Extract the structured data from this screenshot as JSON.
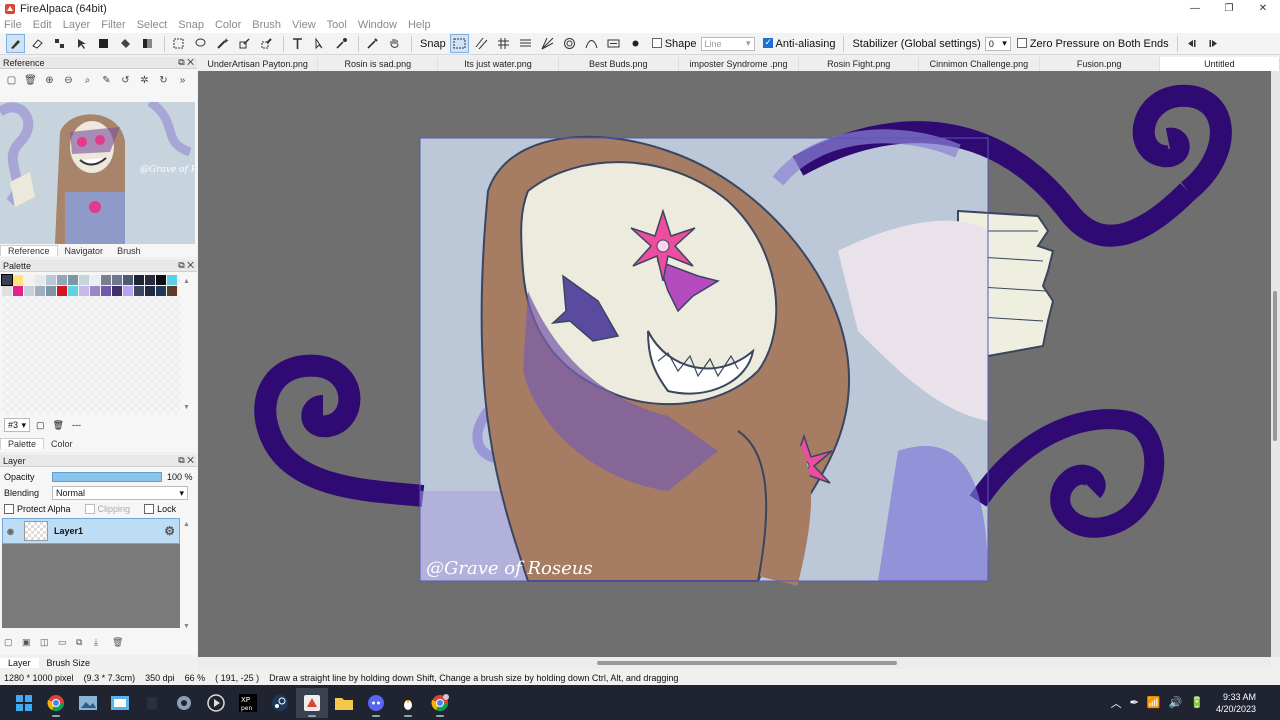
{
  "window": {
    "title": "FireAlpaca (64bit)",
    "controls": [
      "—",
      "❐",
      "✕"
    ]
  },
  "menu": [
    "File",
    "Edit",
    "Layer",
    "Filter",
    "Select",
    "Snap",
    "Color",
    "Brush",
    "View",
    "Tool",
    "Window",
    "Help"
  ],
  "toolbar": {
    "snap_label": "Snap",
    "shape_label": "Shape",
    "shape_value": "Line",
    "antialias_label": "Anti-aliasing",
    "stabilizer_label": "Stabilizer (Global settings)",
    "stabilizer_value": "0",
    "zero_pressure_label": "Zero Pressure on Both Ends"
  },
  "reference_panel": {
    "title": "Reference",
    "tabs": [
      "Reference",
      "Navigator",
      "Brush"
    ],
    "image_watermark": "@Grave of Roseus"
  },
  "palette_panel": {
    "title": "Palette",
    "tabs": [
      "Palette",
      "Color"
    ],
    "palette_number": "#3",
    "dash": "---",
    "swatches": [
      "#3a3f52",
      "#ffe27a",
      "#f2f2f2",
      "#e8e8e8",
      "#b8c8d4",
      "#8fa7b8",
      "#7c96a8",
      "#c8d4dc",
      "#e9eff3",
      "#7a7f92",
      "#6b7a8e",
      "#4d5a70",
      "#1d2534",
      "#2a2a3a",
      "#0d0d12",
      "#5ad0e6",
      "#e0e0e0",
      "#e8208e",
      "#c4d0da",
      "#9db0c0",
      "#7e93a6",
      "#d4141e",
      "#5fd4e0",
      "#c7b8e8",
      "#9987c8",
      "#6e5aa8",
      "#402e6e",
      "#b9a2f0",
      "#3a4660",
      "#1f2a44",
      "#243656",
      "#5c3a24"
    ]
  },
  "layer_panel": {
    "title": "Layer",
    "opacity_label": "Opacity",
    "opacity_value": "100 %",
    "opacity_fraction": 1.0,
    "blending_label": "Blending",
    "blending_value": "Normal",
    "protect_alpha_label": "Protect Alpha",
    "clipping_label": "Clipping",
    "lock_label": "Lock",
    "layer_name": "Layer1"
  },
  "bottom_tabs": [
    "Layer",
    "Brush Size"
  ],
  "doc_tabs": [
    "UnderArtisan Payton.png",
    "Rosin is sad.png",
    "Its just water.png",
    "Best Buds.png",
    "imposter Syndrome .png",
    "Rosin Fight.png",
    "Cinnimon Challenge.png",
    "Fusion.png",
    "Untitled"
  ],
  "active_doc_tab": "Untitled",
  "canvas": {
    "watermark": "@Grave of Roseus"
  },
  "status": {
    "size": "1280 * 1000 pixel",
    "dimensions": "(9.3 * 7.3cm)",
    "dpi": "350 dpi",
    "zoom": "66 %",
    "cursor": "( 191, -25 )",
    "hint": "Draw a straight line by holding down Shift, Change a brush size by holding down Ctrl, Alt, and dragging"
  },
  "taskbar": {
    "time": "9:33 AM",
    "date": "4/20/2023",
    "apps": [
      "start-icon",
      "chrome-icon",
      "photos-icon",
      "mail-icon",
      "blank-app-icon",
      "settings-icon",
      "media-player-icon",
      "xp-pen-icon",
      "steam-icon",
      "firealpaca-icon",
      "file-explorer-icon",
      "discord-icon",
      "penguin-app-icon",
      "chrome-profile-icon"
    ]
  }
}
